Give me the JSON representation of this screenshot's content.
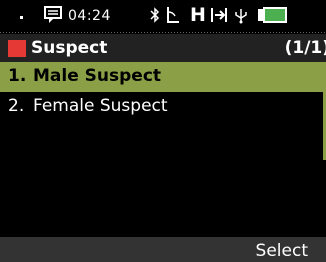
{
  "status_bar": {
    "time": "04:24",
    "icons": [
      "message-icon",
      "bluetooth-icon",
      "signal-icon",
      "hsdpa-icon",
      "data-transfer-icon",
      "usb-icon",
      "battery-icon"
    ],
    "network_letter": "H",
    "battery_color": "#4caf50"
  },
  "title_bar": {
    "title": "Suspect",
    "page": "(1/1)",
    "accent": "#e53935"
  },
  "list": {
    "items": [
      {
        "num": "1.",
        "label": "Male Suspect",
        "selected": true
      },
      {
        "num": "2.",
        "label": "Female Suspect",
        "selected": false
      }
    ],
    "highlight_color": "#8ba046"
  },
  "softkeys": {
    "right": "Select"
  }
}
